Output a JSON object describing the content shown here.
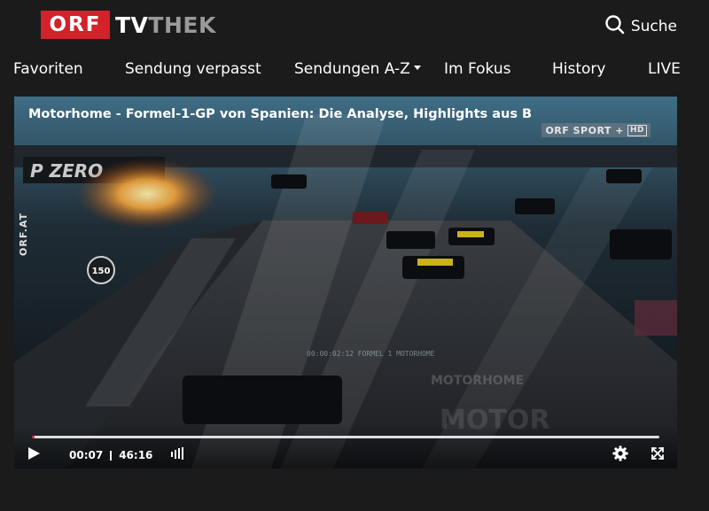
{
  "header": {
    "logo_orf": "ORF",
    "logo_tv": "TV",
    "logo_thek": "THEK",
    "search_label": "Suche",
    "search_icon": "search-icon"
  },
  "nav": {
    "items": [
      {
        "label": "Favoriten"
      },
      {
        "label": "Sendung verpasst"
      },
      {
        "label": "Sendungen A-Z",
        "has_dropdown": true
      },
      {
        "label": "Im Fokus"
      },
      {
        "label": "History"
      },
      {
        "label": "LIVE"
      }
    ]
  },
  "player": {
    "title": "Motorhome - Formel-1-GP von Spanien: Die Analyse, Highlights aus B",
    "badge": "ORF SPORT +",
    "badge_hd": "HD",
    "side_watermark": "ORF.AT",
    "current_time": "00:07",
    "duration": "46:16",
    "progress_fraction": 0.0025,
    "icons": {
      "play": "play-icon",
      "volume": "volume-icon",
      "settings": "gear-icon",
      "fullscreen": "fullscreen-icon"
    }
  },
  "colors": {
    "brand_red": "#d3222a",
    "background": "#1b1b1b",
    "text": "#ffffff",
    "logo_gray": "#9a9a9a"
  }
}
